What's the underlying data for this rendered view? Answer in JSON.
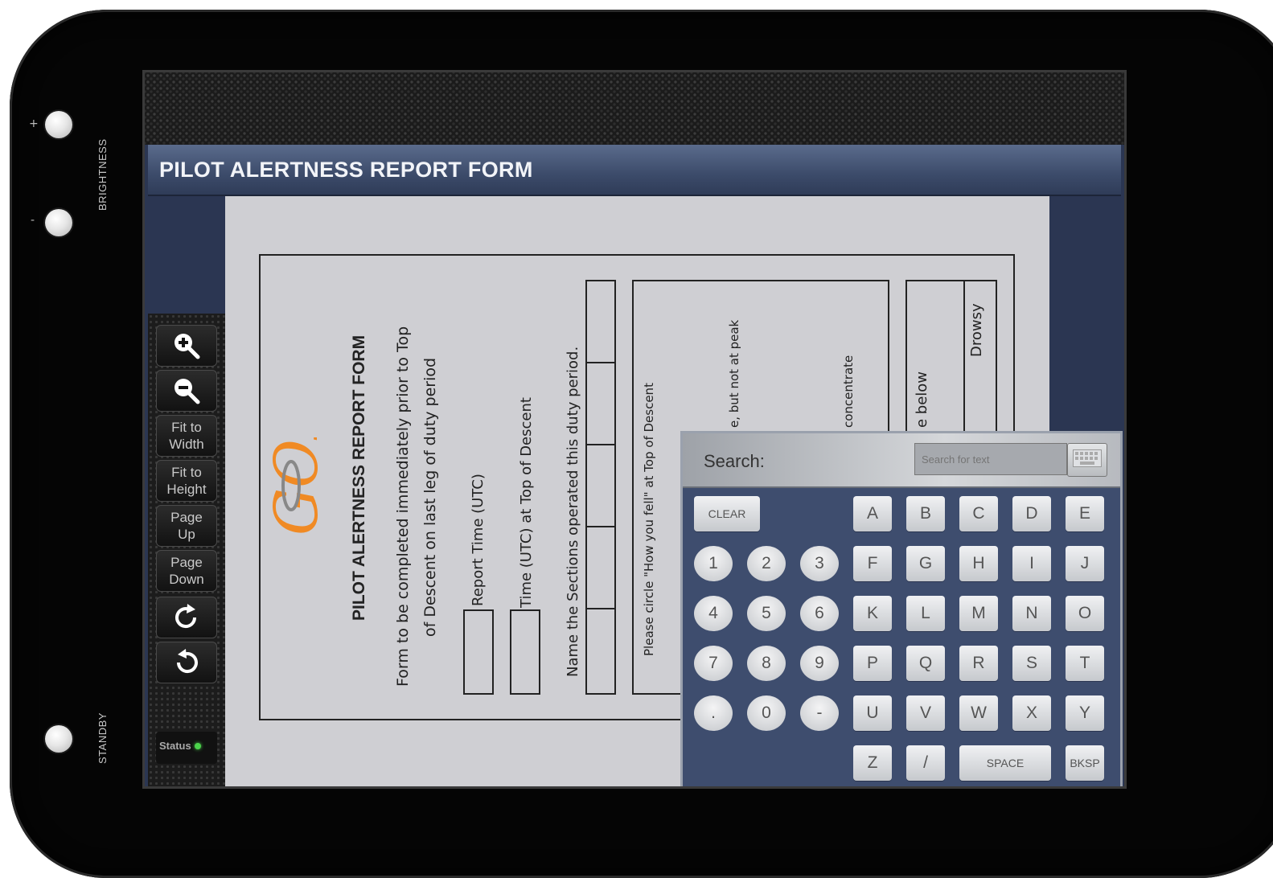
{
  "device": {
    "brightness_label": "BRIGHTNESS",
    "standby_label": "STANDBY",
    "plus_sign": "+",
    "minus_sign": "-"
  },
  "app": {
    "title": "PILOT ALERTNESS REPORT FORM"
  },
  "toolbar": {
    "zoom_in_icon": "zoom-in-icon",
    "zoom_out_icon": "zoom-out-icon",
    "fit_width_line1": "Fit to",
    "fit_width_line2": "Width",
    "fit_height_line1": "Fit to",
    "fit_height_line2": "Height",
    "page_up_line1": "Page",
    "page_up_line2": "Up",
    "page_down_line1": "Page",
    "page_down_line2": "Down",
    "rotate_cw_icon": "rotate-clockwise-icon",
    "rotate_ccw_icon": "rotate-counterclockwise-icon",
    "status_label": "Status",
    "status_color": "#4bd34b"
  },
  "document": {
    "logo_text": "GOL",
    "heading": "PILOT ALERTNESS REPORT FORM",
    "instruction_line1": "Form to be completed immediately prior to Top",
    "instruction_line2": "of Descent on last leg of duty period",
    "report_time_label": "Report Time (UTC)",
    "tod_time_label": "Time (UTC) at Top of Descent",
    "sections_label": "Name the Sections operated this duty period.",
    "circle_prompt": "Please circle \"How you fell\" at Top of Descent",
    "option_partial_1": "e, but not at peak",
    "option_partial_2": "concentrate",
    "option_partial_3": "e below",
    "drowsy_label": "Drowsy"
  },
  "search": {
    "label": "Search:",
    "placeholder": "Search for text",
    "keyboard_icon": "keyboard-icon"
  },
  "keyboard": {
    "clear": "CLEAR",
    "numbers": [
      "1",
      "2",
      "3",
      "4",
      "5",
      "6",
      "7",
      "8",
      "9",
      ".",
      "0",
      "-"
    ],
    "letters": [
      "A",
      "B",
      "C",
      "D",
      "E",
      "F",
      "G",
      "H",
      "I",
      "J",
      "K",
      "L",
      "M",
      "N",
      "O",
      "P",
      "Q",
      "R",
      "S",
      "T",
      "U",
      "V",
      "W",
      "X",
      "Y",
      "Z",
      "/"
    ],
    "space": "SPACE",
    "backspace": "BKSP"
  },
  "colors": {
    "title_bar": "#3c4b6a",
    "page_bg": "#cfcfd3",
    "logo_orange": "#f08a24"
  }
}
